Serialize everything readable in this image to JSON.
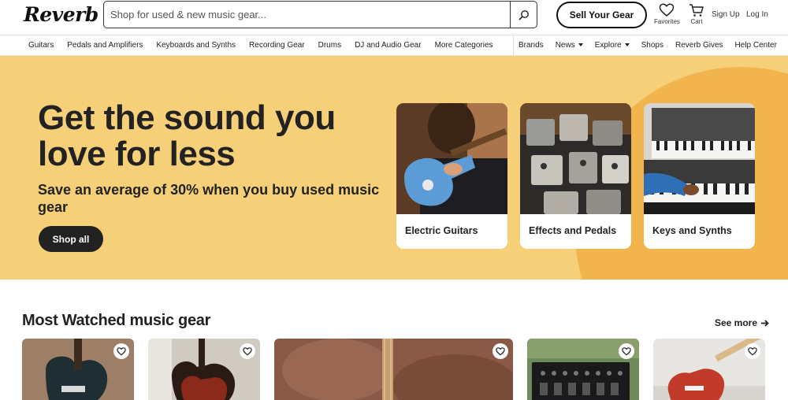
{
  "header": {
    "logo": "Reverb",
    "search_placeholder": "Shop for used & new music gear...",
    "sell_label": "Sell Your Gear",
    "favorites_label": "Favorites",
    "cart_label": "Cart",
    "signup_label": "Sign Up",
    "login_label": "Log In"
  },
  "nav": {
    "left": [
      "Guitars",
      "Pedals and Amplifiers",
      "Keyboards and Synths",
      "Recording Gear",
      "Drums",
      "DJ and Audio Gear",
      "More Categories"
    ],
    "brands": "Brands",
    "news": "News",
    "explore": "Explore",
    "shops": "Shops",
    "gives": "Reverb Gives",
    "help": "Help Center"
  },
  "hero": {
    "title": "Get the sound you love for less",
    "subtitle": "Save an average of 30% when you buy used music gear",
    "cta": "Shop all",
    "categories": [
      "Electric Guitars",
      "Effects and Pedals",
      "Keys and Synths"
    ]
  },
  "watched": {
    "title": "Most Watched music gear",
    "see_more": "See more"
  },
  "colors": {
    "hero_bg": "#f5d078",
    "hero_accent": "#f2b54d",
    "dark": "#222222"
  },
  "icons": [
    "search-icon",
    "heart-icon",
    "cart-icon",
    "chevron-right-icon",
    "caret-down-icon"
  ]
}
